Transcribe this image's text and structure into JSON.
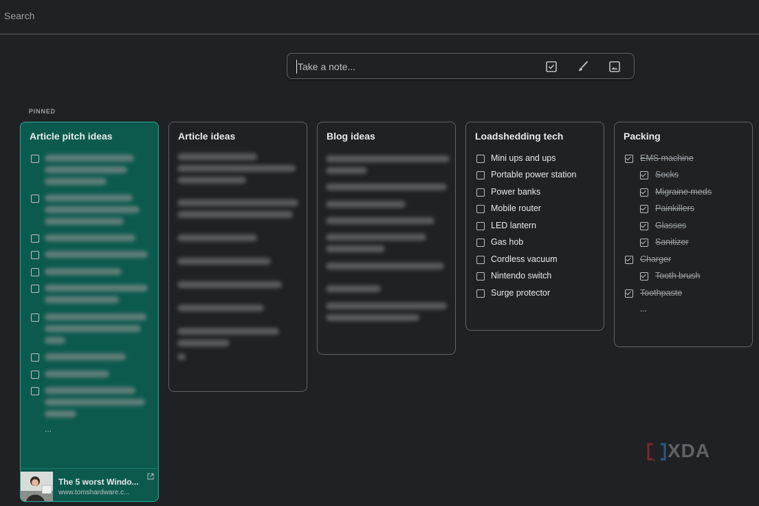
{
  "search": {
    "placeholder": "Search"
  },
  "take_note": {
    "placeholder": "Take a note...",
    "icons": [
      "checkbox-icon",
      "brush-icon",
      "image-icon"
    ]
  },
  "pinned_label": "PINNED",
  "notes": [
    {
      "title": "Article pitch ideas",
      "color": "#0c5a4e",
      "ellipsis": "...",
      "link_preview": {
        "title": "The 5 worst Windo...",
        "url": "www.tomshardware.c..."
      }
    },
    {
      "title": "Article ideas"
    },
    {
      "title": "Blog ideas"
    },
    {
      "title": "Loadshedding tech",
      "items": [
        "Mini ups and ups",
        "Portable power station",
        "Power banks",
        "Mobile router",
        "LED lantern",
        "Gas hob",
        "Cordless vacuum",
        "Nintendo switch",
        "Surge protector"
      ]
    },
    {
      "title": "Packing",
      "items": [
        {
          "text": "EMS machine",
          "checked": true,
          "indent": 0
        },
        {
          "text": "Socks",
          "checked": true,
          "indent": 1
        },
        {
          "text": "Migraine meds",
          "checked": true,
          "indent": 1
        },
        {
          "text": "Painkillers",
          "checked": true,
          "indent": 1
        },
        {
          "text": "Glasses",
          "checked": true,
          "indent": 1
        },
        {
          "text": "Sanitizer",
          "checked": true,
          "indent": 1
        },
        {
          "text": "Charger",
          "checked": true,
          "indent": 0
        },
        {
          "text": "Tooth brush",
          "checked": true,
          "indent": 1
        },
        {
          "text": "Toothpaste",
          "checked": true,
          "indent": 0
        }
      ],
      "ellipsis": "..."
    }
  ],
  "watermark": {
    "text": "XDA"
  }
}
